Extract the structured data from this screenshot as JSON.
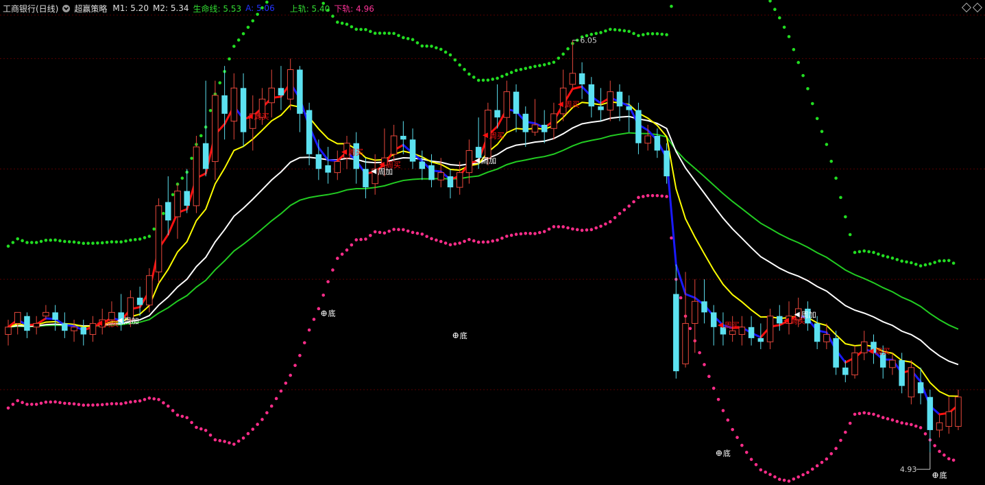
{
  "header": {
    "title": "工商银行(日线)",
    "strategy": "超赢策略",
    "items": [
      {
        "label": "M1: 5.20",
        "color": "#e0e0e0"
      },
      {
        "label": "M2: 5.34",
        "color": "#e0e0e0"
      },
      {
        "label": "生命线: 5.53",
        "color": "#33dd33"
      },
      {
        "label": "A: 5.06",
        "color": "#2233ff"
      },
      {
        "label": "上轨: 5.40",
        "color": "#33dd33"
      },
      {
        "label": "下轨: 4.96",
        "color": "#ff3399"
      }
    ]
  },
  "colors": {
    "background": "#000000",
    "grid": "#5a0000",
    "up": "#e8483c",
    "down": "#5ce1f0",
    "red_line": "#ff1010",
    "blue_line": "#1a1aff",
    "yellow_line": "#ffff00",
    "white_line": "#ffffff",
    "green_line": "#22cc22",
    "upper_band": "#22dd22",
    "lower_band": "#ff2d8a"
  },
  "chart_data": {
    "type": "candlestick",
    "x_range": [
      0,
      100
    ],
    "y_range": [
      4.85,
      6.15
    ],
    "gridlines_y": [
      5.1,
      5.4,
      5.7,
      6.0
    ],
    "annotations": {
      "high_label": "6.05",
      "low_label": "4.93",
      "bottom_label": "底",
      "weekly_buy": "周买",
      "weekly_add": "周加"
    },
    "candles": [
      [
        5.25,
        5.27,
        5.29,
        5.22
      ],
      [
        5.28,
        5.31,
        5.31,
        5.25
      ],
      [
        5.3,
        5.26,
        5.31,
        5.24
      ],
      [
        5.27,
        5.28,
        5.3,
        5.25
      ],
      [
        5.3,
        5.31,
        5.33,
        5.29
      ],
      [
        5.31,
        5.29,
        5.33,
        5.26
      ],
      [
        5.28,
        5.26,
        5.31,
        5.24
      ],
      [
        5.26,
        5.27,
        5.29,
        5.23
      ],
      [
        5.27,
        5.25,
        5.29,
        5.22
      ],
      [
        5.25,
        5.28,
        5.3,
        5.23
      ],
      [
        5.27,
        5.29,
        5.32,
        5.25
      ],
      [
        5.29,
        5.31,
        5.34,
        5.27
      ],
      [
        5.31,
        5.28,
        5.36,
        5.26
      ],
      [
        5.29,
        5.35,
        5.37,
        5.27
      ],
      [
        5.35,
        5.33,
        5.38,
        5.3
      ],
      [
        5.33,
        5.41,
        5.43,
        5.31
      ],
      [
        5.42,
        5.6,
        5.62,
        5.39
      ],
      [
        5.61,
        5.56,
        5.68,
        5.52
      ],
      [
        5.57,
        5.64,
        5.66,
        5.51
      ],
      [
        5.64,
        5.6,
        5.7,
        5.58
      ],
      [
        5.6,
        5.76,
        5.79,
        5.58
      ],
      [
        5.77,
        5.7,
        5.94,
        5.68
      ],
      [
        5.72,
        5.9,
        5.94,
        5.67
      ],
      [
        5.9,
        5.85,
        5.98,
        5.78
      ],
      [
        5.83,
        5.92,
        5.96,
        5.78
      ],
      [
        5.92,
        5.8,
        5.96,
        5.76
      ],
      [
        5.81,
        5.85,
        5.9,
        5.75
      ],
      [
        5.84,
        5.89,
        5.92,
        5.82
      ],
      [
        5.88,
        5.92,
        5.97,
        5.84
      ],
      [
        5.92,
        5.9,
        5.98,
        5.86
      ],
      [
        5.89,
        5.97,
        6.0,
        5.86
      ],
      [
        5.97,
        5.85,
        5.98,
        5.8
      ],
      [
        5.86,
        5.74,
        5.88,
        5.71
      ],
      [
        5.74,
        5.7,
        5.78,
        5.67
      ],
      [
        5.71,
        5.69,
        5.76,
        5.66
      ],
      [
        5.69,
        5.72,
        5.75,
        5.67
      ],
      [
        5.73,
        5.77,
        5.79,
        5.7
      ],
      [
        5.77,
        5.7,
        5.8,
        5.66
      ],
      [
        5.7,
        5.65,
        5.73,
        5.62
      ],
      [
        5.66,
        5.7,
        5.74,
        5.63
      ],
      [
        5.71,
        5.73,
        5.81,
        5.68
      ],
      [
        5.74,
        5.79,
        5.82,
        5.72
      ],
      [
        5.79,
        5.78,
        5.83,
        5.74
      ],
      [
        5.78,
        5.72,
        5.81,
        5.7
      ],
      [
        5.72,
        5.7,
        5.75,
        5.67
      ],
      [
        5.71,
        5.67,
        5.74,
        5.65
      ],
      [
        5.67,
        5.69,
        5.73,
        5.65
      ],
      [
        5.68,
        5.65,
        5.7,
        5.62
      ],
      [
        5.65,
        5.69,
        5.72,
        5.63
      ],
      [
        5.69,
        5.75,
        5.78,
        5.66
      ],
      [
        5.76,
        5.73,
        5.84,
        5.7
      ],
      [
        5.73,
        5.86,
        5.88,
        5.71
      ],
      [
        5.86,
        5.84,
        5.93,
        5.81
      ],
      [
        5.84,
        5.91,
        5.94,
        5.8
      ],
      [
        5.91,
        5.85,
        5.93,
        5.8
      ],
      [
        5.85,
        5.8,
        5.87,
        5.76
      ],
      [
        5.8,
        5.82,
        5.89,
        5.79
      ],
      [
        5.82,
        5.8,
        5.86,
        5.77
      ],
      [
        5.81,
        5.85,
        5.88,
        5.78
      ],
      [
        5.85,
        5.92,
        5.97,
        5.83
      ],
      [
        5.93,
        5.96,
        6.05,
        5.92
      ],
      [
        5.96,
        5.93,
        5.99,
        5.89
      ],
      [
        5.93,
        5.87,
        5.95,
        5.84
      ],
      [
        5.87,
        5.86,
        5.92,
        5.83
      ],
      [
        5.86,
        5.91,
        5.94,
        5.83
      ],
      [
        5.91,
        5.87,
        5.93,
        5.83
      ],
      [
        5.87,
        5.86,
        5.9,
        5.8
      ],
      [
        5.86,
        5.77,
        5.88,
        5.74
      ],
      [
        5.77,
        5.79,
        5.82,
        5.75
      ],
      [
        5.79,
        5.75,
        5.81,
        5.73
      ],
      [
        5.75,
        5.68,
        5.77,
        5.66
      ],
      [
        5.36,
        5.15,
        5.44,
        5.13
      ],
      [
        5.17,
        5.28,
        5.42,
        5.16
      ],
      [
        5.28,
        5.34,
        5.4,
        5.2
      ],
      [
        5.34,
        5.31,
        5.4,
        5.28
      ],
      [
        5.31,
        5.27,
        5.33,
        5.22
      ],
      [
        5.27,
        5.25,
        5.31,
        5.22
      ],
      [
        5.25,
        5.26,
        5.3,
        5.23
      ],
      [
        5.25,
        5.27,
        5.3,
        5.22
      ],
      [
        5.27,
        5.24,
        5.3,
        5.22
      ],
      [
        5.24,
        5.23,
        5.28,
        5.21
      ],
      [
        5.23,
        5.3,
        5.32,
        5.21
      ],
      [
        5.3,
        5.28,
        5.33,
        5.26
      ],
      [
        5.28,
        5.3,
        5.34,
        5.25
      ],
      [
        5.29,
        5.32,
        5.35,
        5.27
      ],
      [
        5.32,
        5.28,
        5.34,
        5.26
      ],
      [
        5.28,
        5.23,
        5.3,
        5.21
      ],
      [
        5.23,
        5.25,
        5.28,
        5.21
      ],
      [
        5.24,
        5.16,
        5.26,
        5.14
      ],
      [
        5.16,
        5.14,
        5.18,
        5.12
      ],
      [
        5.14,
        5.2,
        5.22,
        5.13
      ],
      [
        5.2,
        5.23,
        5.26,
        5.18
      ],
      [
        5.23,
        5.2,
        5.25,
        5.17
      ],
      [
        5.2,
        5.16,
        5.22,
        5.13
      ],
      [
        5.16,
        5.18,
        5.2,
        5.14
      ],
      [
        5.18,
        5.11,
        5.2,
        5.09
      ],
      [
        5.08,
        5.16,
        5.18,
        5.06
      ],
      [
        5.12,
        5.09,
        5.16,
        5.06
      ],
      [
        5.08,
        4.99,
        5.1,
        4.93
      ],
      [
        4.99,
        5.01,
        5.03,
        4.97
      ],
      [
        5.0,
        5.04,
        5.08,
        4.98
      ],
      [
        5.0,
        5.08,
        5.1,
        4.99
      ]
    ]
  }
}
